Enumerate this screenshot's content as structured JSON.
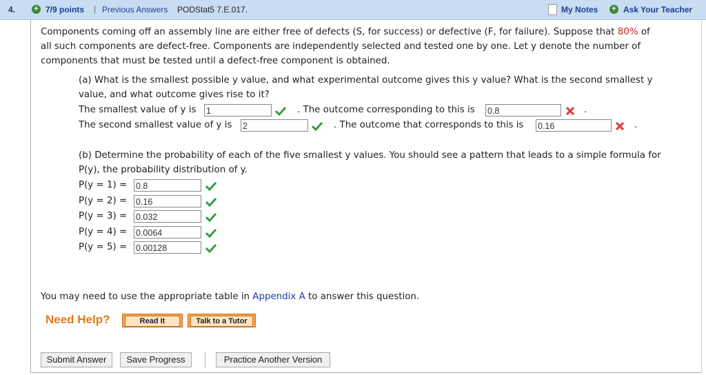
{
  "header": {
    "question_number": "4.",
    "points": "7/9 points",
    "separator": "|",
    "previous_answers": "Previous Answers",
    "question_code": "PODStat5 7.E.017.",
    "my_notes": "My Notes",
    "ask_teacher": "Ask Your Teacher"
  },
  "problem": {
    "line1_a": "Components coming off an assembly line are either free of defects (S, for success) or defective (F, for failure). Suppose that ",
    "line1_pct": "80%",
    "line1_b": " of",
    "line2": "all such components are defect-free. Components are independently selected and tested one by one. Let y denote the number of",
    "line3": "components that must be tested until a defect-free component is obtained."
  },
  "part_a": {
    "q_line1": "(a) What is the smallest possible y value, and what experimental outcome gives this y value? What is the second smallest y",
    "q_line2": "value, and what outcome gives rise to it?",
    "smallest_label": "The smallest value of y is",
    "smallest_value": "1",
    "outcome1_label": ". The outcome corresponding to this is",
    "outcome1_value": "0.8",
    "second_label": "The second smallest value of y is",
    "second_value": "2",
    "outcome2_label": ". The outcome that corresponds to this is",
    "outcome2_value": "0.16",
    "period": "."
  },
  "part_b": {
    "q_line1": "(b) Determine the probability of each of the five smallest y values. You should see a pattern that leads to a simple formula for",
    "q_line2": "P(y), the probability distribution of y.",
    "rows": [
      {
        "label": "P(y = 1) =",
        "value": "0.8"
      },
      {
        "label": "P(y = 2) =",
        "value": "0.16"
      },
      {
        "label": "P(y = 3) =",
        "value": "0.032"
      },
      {
        "label": "P(y = 4) =",
        "value": "0.0064"
      },
      {
        "label": "P(y = 5) =",
        "value": "0.00128"
      }
    ]
  },
  "table_note": {
    "before": "You may need to use the appropriate table in ",
    "link": "Appendix A",
    "after": " to answer this question."
  },
  "help": {
    "label": "Need Help?",
    "read_it": "Read It",
    "talk_tutor": "Talk to a Tutor"
  },
  "footer": {
    "submit": "Submit Answer",
    "save": "Save Progress",
    "practice": "Practice Another Version"
  },
  "colors": {
    "header_bg": "#c8dcf2",
    "link_blue": "#1a3e8e",
    "correct_green": "#3a9a3a",
    "wrong_red": "#e04040",
    "help_orange": "#e07b16"
  },
  "icons": {
    "correct": "check-icon",
    "incorrect": "x-mark-icon",
    "plus": "plus-circle-icon",
    "notes": "note-icon"
  }
}
